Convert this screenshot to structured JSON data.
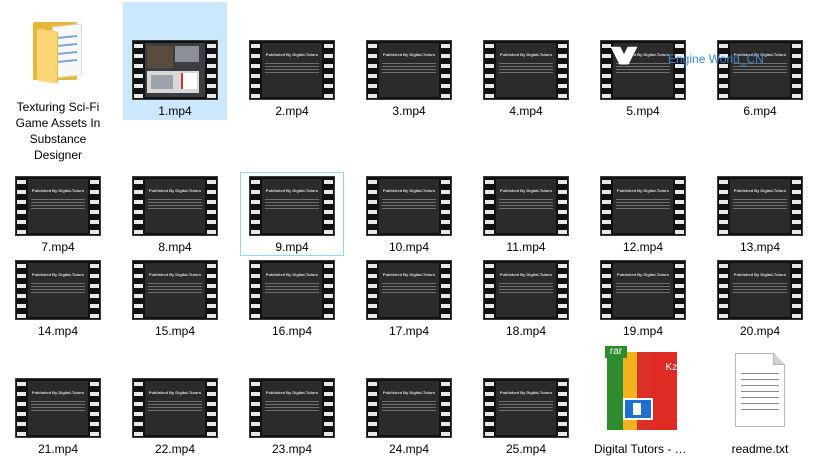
{
  "folder": {
    "label": "Texturing Sci-Fi Game Assets In Substance Designer"
  },
  "thumbnail_title": "Published By Digital-Tutors",
  "watermark": "Engine World_CN",
  "videos": [
    {
      "label": "1.mp4"
    },
    {
      "label": "2.mp4"
    },
    {
      "label": "3.mp4"
    },
    {
      "label": "4.mp4"
    },
    {
      "label": "5.mp4"
    },
    {
      "label": "6.mp4"
    },
    {
      "label": "7.mp4"
    },
    {
      "label": "8.mp4"
    },
    {
      "label": "9.mp4"
    },
    {
      "label": "10.mp4"
    },
    {
      "label": "11.mp4"
    },
    {
      "label": "12.mp4"
    },
    {
      "label": "13.mp4"
    },
    {
      "label": "14.mp4"
    },
    {
      "label": "15.mp4"
    },
    {
      "label": "16.mp4"
    },
    {
      "label": "17.mp4"
    },
    {
      "label": "18.mp4"
    },
    {
      "label": "19.mp4"
    },
    {
      "label": "20.mp4"
    },
    {
      "label": "21.mp4"
    },
    {
      "label": "22.mp4"
    },
    {
      "label": "23.mp4"
    },
    {
      "label": "24.mp4"
    },
    {
      "label": "25.mp4"
    }
  ],
  "archive": {
    "label": "Digital Tutors - Texturing Sci-Fi Game Assets In Substance Designer",
    "tag_left": "rar",
    "tag_right": "Kzip"
  },
  "textfile": {
    "label": "readme.txt"
  },
  "colors": {
    "selection": "#cce8ff",
    "focus": "#99d1ff",
    "watermark": "#3b86d1"
  }
}
